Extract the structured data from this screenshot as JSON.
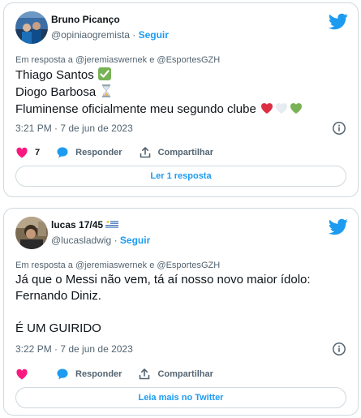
{
  "colors": {
    "accent": "#1d9bf0",
    "secondary_text": "#536471",
    "like_red": "#f91880",
    "border": "#cfd9de"
  },
  "tweets": [
    {
      "author_name": "Bruno Picanço",
      "handle": "@opiniaogremista",
      "follow_label": "Seguir",
      "reply_to": "Em resposta a @jeremiaswernek e @EsportesGZH",
      "lines": [
        "Thiago Santos ",
        "Diogo Barbosa ",
        "Fluminense oficialmente meu segundo clube "
      ],
      "emoji_icons": [
        "check-mark-icon",
        "hourglass-icon",
        "red-heart-icon",
        "white-heart-icon",
        "green-heart-icon"
      ],
      "timestamp": "3:21 PM · 7 de jun de 2023",
      "like_count": "7",
      "reply_label": "Responder",
      "share_label": "Compartilhar",
      "bottom_button": "Ler 1 resposta"
    },
    {
      "author_name": "lucas 17/45",
      "handle": "@lucasladwig",
      "follow_label": "Seguir",
      "reply_to": "Em resposta a @jeremiaswernek e @EsportesGZH",
      "lines": [
        "Já que o Messi não vem, tá aí nosso novo maior ídolo:",
        "Fernando Diniz.",
        "",
        "É UM GUIRIDO"
      ],
      "timestamp": "3:22 PM · 7 de jun de 2023",
      "like_count": "",
      "reply_label": "Responder",
      "share_label": "Compartilhar",
      "bottom_button": "Leia mais no Twitter"
    }
  ]
}
